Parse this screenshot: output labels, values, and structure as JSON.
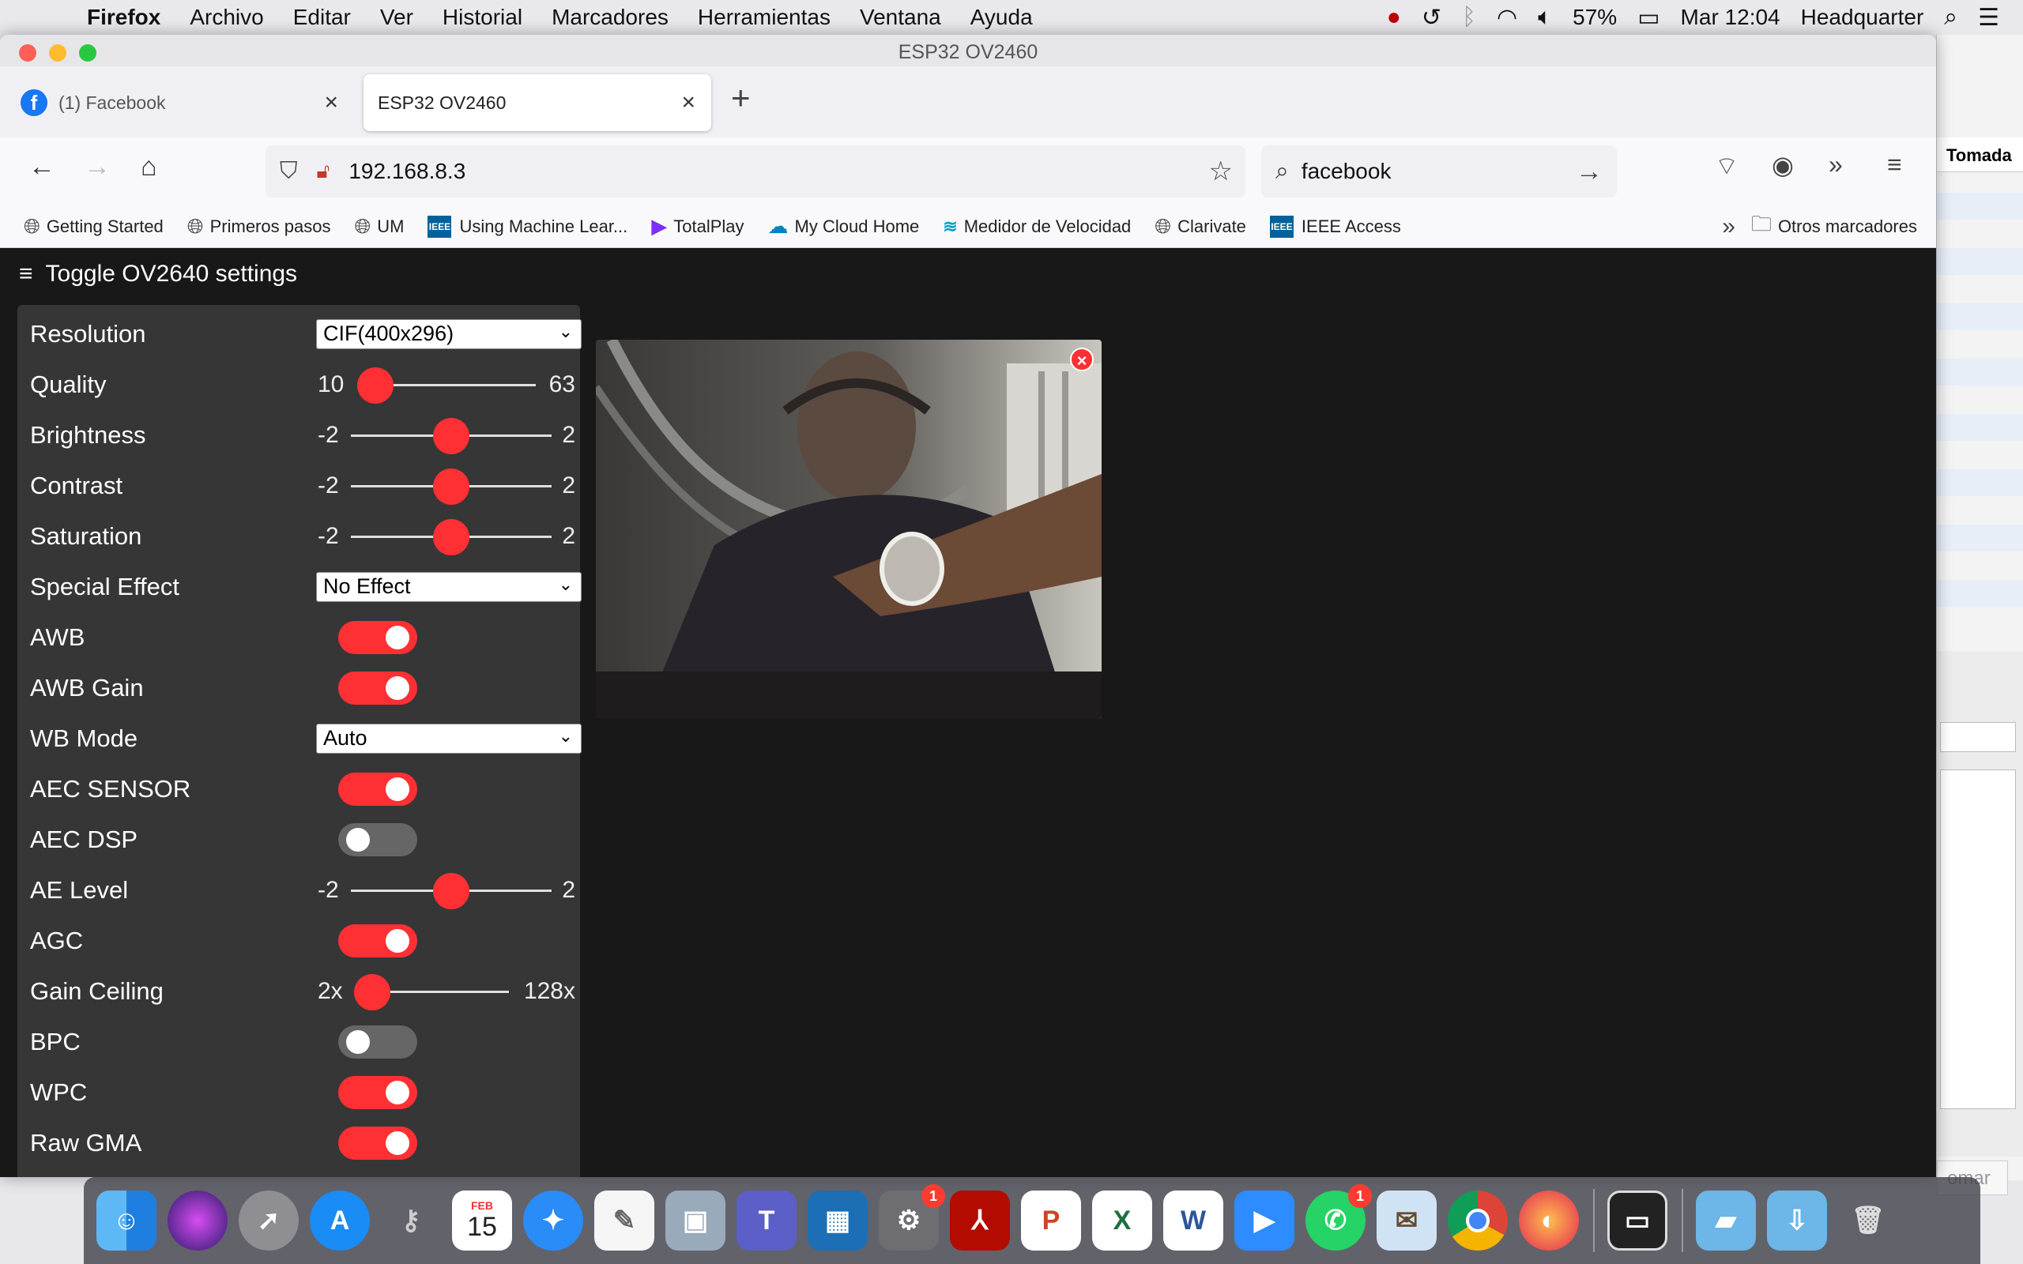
{
  "menubar": {
    "app": "Firefox",
    "items": [
      "Archivo",
      "Editar",
      "Ver",
      "Historial",
      "Marcadores",
      "Herramientas",
      "Ventana",
      "Ayuda"
    ],
    "battery": "57%",
    "clock": "Mar 12:04",
    "user": "Headquarter"
  },
  "window": {
    "title": "ESP32 OV2460"
  },
  "tabs": [
    {
      "label": "(1) Facebook"
    },
    {
      "label": "ESP32 OV2460"
    }
  ],
  "nav": {
    "url": "192.168.8.3",
    "search": "facebook"
  },
  "bookmarks": [
    {
      "label": "Getting Started"
    },
    {
      "label": "Primeros pasos"
    },
    {
      "label": "UM"
    },
    {
      "label": "Using Machine Lear..."
    },
    {
      "label": "TotalPlay"
    },
    {
      "label": "My Cloud Home"
    },
    {
      "label": "Medidor de Velocidad"
    },
    {
      "label": "Clarivate"
    },
    {
      "label": "IEEE Access"
    }
  ],
  "bookmarks_other": "Otros marcadores",
  "bg_app": {
    "header": "Tomada",
    "button": "omar"
  },
  "page": {
    "toggle_label": "Toggle OV2640 settings",
    "controls": {
      "resolution": {
        "label": "Resolution",
        "value": "CIF(400x296)"
      },
      "quality": {
        "label": "Quality",
        "min": "10",
        "max": "63",
        "value": 10
      },
      "brightness": {
        "label": "Brightness",
        "min": "-2",
        "max": "2",
        "value": 0
      },
      "contrast": {
        "label": "Contrast",
        "min": "-2",
        "max": "2",
        "value": 0
      },
      "saturation": {
        "label": "Saturation",
        "min": "-2",
        "max": "2",
        "value": 0
      },
      "special_effect": {
        "label": "Special Effect",
        "value": "No Effect"
      },
      "awb": {
        "label": "AWB",
        "on": true
      },
      "awb_gain": {
        "label": "AWB Gain",
        "on": true
      },
      "wb_mode": {
        "label": "WB Mode",
        "value": "Auto"
      },
      "aec_sensor": {
        "label": "AEC SENSOR",
        "on": true
      },
      "aec_dsp": {
        "label": "AEC DSP",
        "on": false
      },
      "ae_level": {
        "label": "AE Level",
        "min": "-2",
        "max": "2",
        "value": 0
      },
      "agc": {
        "label": "AGC",
        "on": true
      },
      "gain_ceiling": {
        "label": "Gain Ceiling",
        "min": "2x",
        "max": "128x",
        "value": 0
      },
      "bpc": {
        "label": "BPC",
        "on": false
      },
      "wpc": {
        "label": "WPC",
        "on": true
      },
      "raw_gma": {
        "label": "Raw GMA",
        "on": true
      }
    }
  },
  "dock": {
    "apps": [
      "Finder",
      "Siri",
      "Launchpad",
      "App Store",
      "Keychain",
      "Calendar",
      "Safari",
      "TextEdit",
      "Preview",
      "Teams",
      "VirtualBox",
      "System Preferences",
      "Acrobat",
      "PowerPoint",
      "Excel",
      "Word",
      "Zoom",
      "WhatsApp",
      "Mail",
      "Chrome",
      "Firefox",
      "Terminal",
      "Applications",
      "Downloads",
      "Trash"
    ],
    "calendar_month": "FEB",
    "calendar_day": "15",
    "badge_system_prefs": "1",
    "badge_whatsapp": "1"
  },
  "colors": {
    "accent": "#ff3034",
    "page_bg": "#181818",
    "panel_bg": "#363636"
  }
}
